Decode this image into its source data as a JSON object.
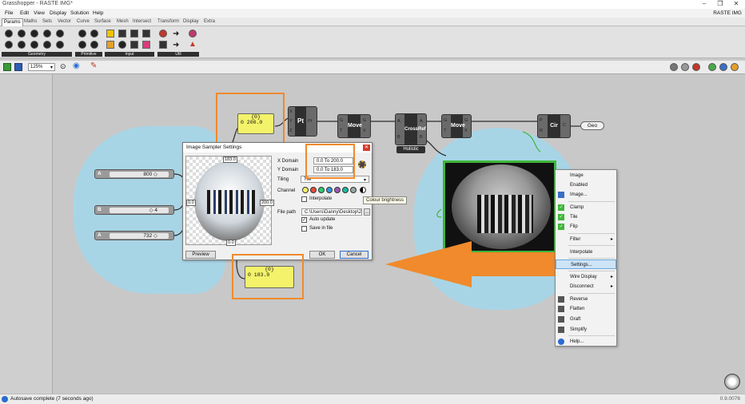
{
  "app": {
    "title": "Grasshopper - RASTE IMG*",
    "doc": "RASTE IMG",
    "window_controls": [
      "–",
      "❐",
      "✕"
    ]
  },
  "menu": [
    "File",
    "Edit",
    "View",
    "Display",
    "Solution",
    "Help"
  ],
  "tabs": [
    "Params",
    "Maths",
    "Sets",
    "Vector",
    "Curve",
    "Surface",
    "Mesh",
    "Intersect",
    "Transform",
    "Display",
    "Extra"
  ],
  "ribbon_groups": {
    "geometry": "Geometry",
    "primitive": "Primitive",
    "input": "Input",
    "util": "Util"
  },
  "canvasbar": {
    "zoom": "125%"
  },
  "panels": {
    "top": {
      "header": "{0}",
      "value": "0 200.0"
    },
    "bottom": {
      "header": "{0}",
      "value": "0 183.0"
    }
  },
  "sliders": [
    {
      "label": "A",
      "value": "800 ◇"
    },
    {
      "label": "B",
      "value": "◇ 4"
    },
    {
      "label": "A",
      "value": "732 ◇"
    }
  ],
  "nodes": {
    "pt": {
      "name": "Pt",
      "inputs": [
        "X",
        "Y",
        "Z"
      ],
      "output": "Pt"
    },
    "move1": {
      "name": "Move",
      "inputs": [
        "G",
        "T"
      ],
      "outputs": [
        "G",
        "X"
      ]
    },
    "crossref": {
      "name": "CrossRef",
      "inputs": [
        "A",
        "B"
      ],
      "outputs": [
        "A",
        "B"
      ],
      "badge": "Holistic"
    },
    "move2": {
      "name": "Move",
      "inputs": [
        "G",
        "T"
      ],
      "outputs": [
        "G",
        "X"
      ]
    },
    "cir": {
      "name": "Cir",
      "inputs": [
        "P",
        "R"
      ],
      "output": "C"
    },
    "geo": {
      "name": "Geo"
    }
  },
  "dialog": {
    "title": "Image Sampler Settings",
    "x_domain_label": "X Domain",
    "x_domain": "0.0 To 200.0",
    "y_domain_label": "Y Domain",
    "y_domain": "0.0 To 183.0",
    "tiling_label": "Tiling",
    "tiling_value": "Tile",
    "channel_label": "Channel",
    "interpolate": "Interpolate",
    "file_path_label": "File path",
    "file_path": "C:\\Users\\Danny\\Desktop\\200",
    "auto_update": "Auto update",
    "save_in_file": "Save in file",
    "preview_btn": "Preview",
    "ok_btn": "OK",
    "cancel_btn": "Cancel",
    "img_top": "183.0",
    "img_left": "0.0",
    "img_right": "200.0",
    "img_bottom": "0.0"
  },
  "tooltip": "Colour brightness",
  "context_menu": [
    {
      "label": "Image",
      "check": "none"
    },
    {
      "label": "Enabled",
      "check": "none"
    },
    {
      "label": "Image...",
      "check": "none"
    },
    {
      "label": "Clamp",
      "check": "checked"
    },
    {
      "label": "Tile",
      "check": "checked"
    },
    {
      "label": "Flip",
      "check": "checked"
    },
    {
      "label": "Filter",
      "check": "none",
      "sub": "▸"
    },
    {
      "label": "Interpolate",
      "check": "none"
    },
    {
      "label": "Settings...",
      "check": "none"
    },
    {
      "label": "Wire Display",
      "check": "none",
      "sub": "▸"
    },
    {
      "label": "Disconnect",
      "check": "none",
      "sub": "▸"
    },
    {
      "label": "Reverse",
      "check": "icon"
    },
    {
      "label": "Flatten",
      "check": "icon"
    },
    {
      "label": "Graft",
      "check": "icon"
    },
    {
      "label": "Simplify",
      "check": "icon"
    },
    {
      "label": "Help...",
      "check": "info"
    }
  ],
  "status": {
    "message": "Autosave complete (7 seconds ago)",
    "version": "0.9.0076"
  },
  "colors": {
    "accent": "#f08a2c",
    "blob": "#a8d5e6",
    "panel": "#f4f26a",
    "node": "#2f2f2f",
    "selected_green": "#3fb53a"
  }
}
